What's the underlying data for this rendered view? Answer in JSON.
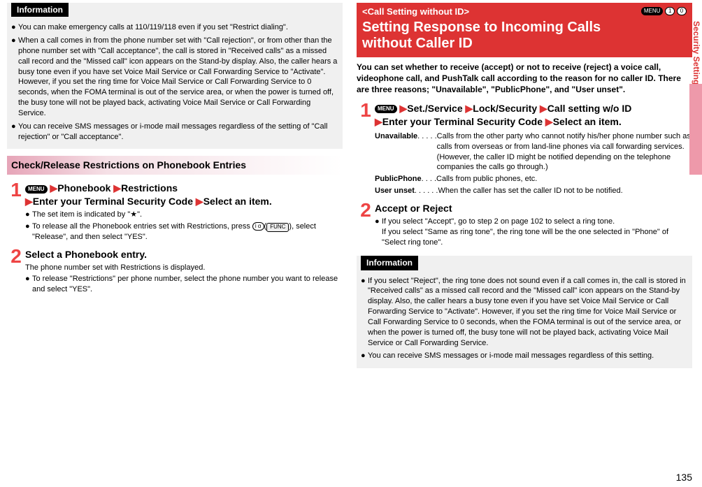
{
  "left": {
    "info_header": "Information",
    "info_bullets": [
      "You can make emergency calls at 110/119/118 even if you set \"Restrict dialing\".",
      "When a call comes in from the phone number set with \"Call rejection\", or from other than the phone number set with \"Call acceptance\", the call is stored in \"Received calls\" as a missed call record and the \"Missed call\" icon appears on the Stand-by display. Also, the caller hears a busy tone even if you have set Voice Mail Service or Call Forwarding Service to \"Activate\". However, if you set the ring time for Voice Mail Service or Call Forwarding Service to 0 seconds, when the FOMA terminal is out of the service area, or when the power is turned off, the busy tone will not be played back, activating Voice Mail Service or Call Forwarding Service.",
      "You can receive SMS messages or i-mode mail messages regardless of the setting of \"Call rejection\" or \"Call acceptance\"."
    ],
    "pink_header": "Check/Release Restrictions on Phonebook Entries",
    "step1": {
      "menu_key": "MENU",
      "seg1": "Phonebook",
      "seg2": "Restrictions",
      "line2": "Enter your Terminal Security Code",
      "seg3": "Select an item.",
      "b1": "The set item is indicated by \"★\".",
      "b2_pre": "To release all the Phonebook entries set with Restrictions, press ",
      "b2_key1": "i α",
      "b2_key2": "FUNC",
      "b2_post": ", select \"Release\", and then select \"YES\"."
    },
    "step2": {
      "title": "Select a Phonebook entry.",
      "line": "The phone number set with Restrictions is displayed.",
      "b1": "To release \"Restrictions\" per phone number, select the phone number you want to release and select \"YES\"."
    }
  },
  "right": {
    "header_thin": "<Call Setting without ID>",
    "header_icons": {
      "menu": "MENU",
      "k1": "1",
      "k2": "0"
    },
    "header_big1": "Setting Response to Incoming Calls",
    "header_big2": "without Caller ID",
    "intro": "You can set whether to receive (accept) or not to receive (reject) a voice call, videophone call, and PushTalk call according to the reason for no caller ID. There are three reasons; \"Unavailable\", \"PublicPhone\", and \"User unset\".",
    "step1": {
      "menu_key": "MENU",
      "seg1": "Set./Service",
      "seg2": "Lock/Security",
      "seg3": "Call setting w/o ID",
      "line2a": "Enter your Terminal Security Code",
      "line2b": "Select an item."
    },
    "defs": [
      {
        "term": "Unavailable",
        "dots": " . . . . . ",
        "val": "Calls from the other party who cannot notify his/her phone number such as calls from overseas or from land-line phones via call forwarding services.\n(However, the caller ID might be notified depending on the telephone companies the calls go through.)"
      },
      {
        "term": "PublicPhone",
        "dots": " . . . . ",
        "val": "Calls from public phones, etc."
      },
      {
        "term": "User unset",
        "dots": ". . . . . . ",
        "val": "When the caller has set the caller ID not to be notified."
      }
    ],
    "step2": {
      "title": "Accept or Reject",
      "b1": "If you select \"Accept\", go to step 2 on page 102 to select a ring tone.\nIf you select \"Same as ring tone\", the ring tone will be the one selected in \"Phone\" of \"Select ring tone\"."
    },
    "info_header": "Information",
    "info_bullets": [
      "If you select \"Reject\", the ring tone does not sound even if a call comes in, the call is stored in \"Received calls\" as a missed call record and the \"Missed call\" icon appears on the Stand-by display. Also, the caller hears a busy tone even if you have set Voice Mail Service or Call Forwarding Service to \"Activate\". However, if you set the ring time for Voice Mail Service or Call Forwarding Service to 0 seconds, when the FOMA terminal is out of the service area, or when the power is turned off, the busy tone will not be played back, activating Voice Mail Service or Call Forwarding Service.",
      "You can receive SMS messages or i-mode mail messages regardless of this setting."
    ]
  },
  "side_label": "Security Settings",
  "page_number": "135"
}
